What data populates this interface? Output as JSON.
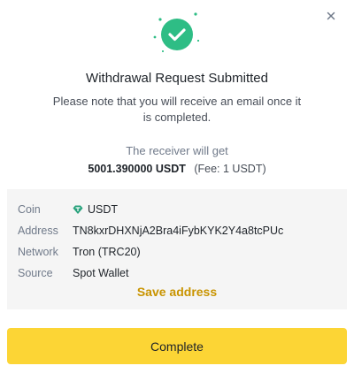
{
  "dialog": {
    "title": "Withdrawal Request Submitted",
    "note": "Please note that you will receive an email once it is completed.",
    "receiver_label": "The receiver will get",
    "amount": "5001.390000 USDT",
    "fee": "(Fee: 1 USDT)"
  },
  "details": {
    "rows": [
      {
        "label": "Coin",
        "value": "USDT",
        "icon": "tether-diamond-icon"
      },
      {
        "label": "Address",
        "value": "TN8kxrDHXNjA2Bra4iFybKYK2Y4a8tcPUc"
      },
      {
        "label": "Network",
        "value": "Tron (TRC20)"
      },
      {
        "label": "Source",
        "value": "Spot Wallet"
      }
    ],
    "save_label": "Save address"
  },
  "actions": {
    "complete_label": "Complete",
    "close_icon": "close-icon"
  },
  "colors": {
    "success": "#2ebd85",
    "accent": "#fcd535",
    "link": "#c99400",
    "panel": "#f5f5f5",
    "coin": "#26a17b"
  }
}
